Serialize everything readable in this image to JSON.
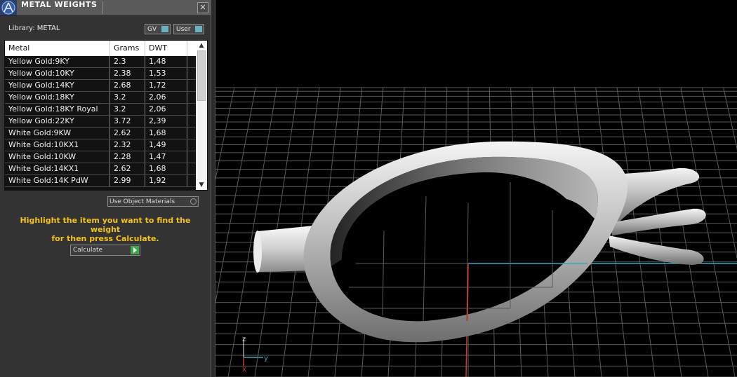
{
  "window": {
    "title": "METAL WEIGHTS",
    "close_label": "✕"
  },
  "library": {
    "label": "Library: METAL",
    "gv_label": "GV",
    "user_label": "User"
  },
  "table": {
    "columns": [
      "Metal",
      "Grams",
      "DWT"
    ],
    "rows": [
      [
        "Yellow Gold:9KY",
        "2.3",
        "1,48"
      ],
      [
        "Yellow Gold:10KY",
        "2.38",
        "1,53"
      ],
      [
        "Yellow Gold:14KY",
        "2.68",
        "1,72"
      ],
      [
        "Yellow Gold:18KY",
        "3.2",
        "2,06"
      ],
      [
        "Yellow Gold:18KY Royal",
        "3.2",
        "2,06"
      ],
      [
        "Yellow Gold:22KY",
        "3.72",
        "2,39"
      ],
      [
        "White Gold:9KW",
        "2.62",
        "1,68"
      ],
      [
        "White Gold:10KX1",
        "2.32",
        "1,49"
      ],
      [
        "White Gold:10KW",
        "2.28",
        "1,47"
      ],
      [
        "White Gold:14KX1",
        "2.62",
        "1,68"
      ],
      [
        "White Gold:14K PdW",
        "2.99",
        "1,92"
      ]
    ]
  },
  "use_object_materials_label": "Use Object Materials",
  "hint": {
    "line1": "Highlight the item you want to find the weight",
    "line2": "for then press Calculate."
  },
  "calculate_label": "Calculate",
  "axis_labels": {
    "z": "z",
    "y": "y",
    "x": "x"
  },
  "colors": {
    "panel_bg": "#333333",
    "hint_text": "#f4c21a",
    "grid_line": "#5a5a5a",
    "axis_x_red": "#c83a2a",
    "axis_y_cyan": "#3aa6c0"
  },
  "icons": {
    "logo": "matrix-logo-icon",
    "close": "close-icon",
    "toggle": "toggle-indicator-icon",
    "play": "play-icon"
  }
}
